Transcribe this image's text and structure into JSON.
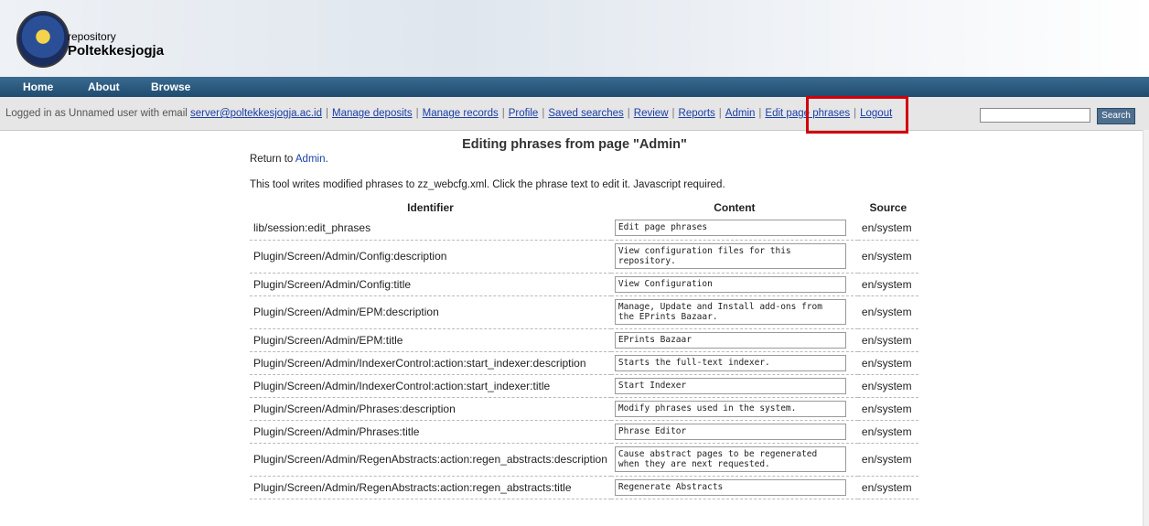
{
  "header": {
    "logo_line1": "repository",
    "logo_line2": "Poltekkesjogja"
  },
  "nav": {
    "home": "Home",
    "about": "About",
    "browse": "Browse"
  },
  "userbar": {
    "prefix": "Logged in as Unnamed user with email ",
    "email": "server@poltekkesjogja.ac.id",
    "links": [
      "Manage deposits",
      "Manage records",
      "Profile",
      "Saved searches",
      "Review",
      "Reports",
      "Admin",
      "Edit page phrases",
      "Logout"
    ],
    "search_button": "Search"
  },
  "page": {
    "title": "Editing phrases from page \"Admin\"",
    "return_prefix": "Return to ",
    "return_link": "Admin",
    "return_suffix": ".",
    "info": "This tool writes modified phrases to zz_webcfg.xml. Click the phrase text to edit it. Javascript required."
  },
  "table": {
    "headers": [
      "Identifier",
      "Content",
      "Source"
    ],
    "rows": [
      {
        "id": "lib/session:edit_phrases",
        "content": "Edit page phrases",
        "source": "en/system"
      },
      {
        "id": "Plugin/Screen/Admin/Config:description",
        "content": "View configuration files for this repository.",
        "source": "en/system"
      },
      {
        "id": "Plugin/Screen/Admin/Config:title",
        "content": "View Configuration",
        "source": "en/system"
      },
      {
        "id": "Plugin/Screen/Admin/EPM:description",
        "content": "Manage, Update and Install add-ons from the EPrints Bazaar.",
        "source": "en/system"
      },
      {
        "id": "Plugin/Screen/Admin/EPM:title",
        "content": "EPrints Bazaar",
        "source": "en/system"
      },
      {
        "id": "Plugin/Screen/Admin/IndexerControl:action:start_indexer:description",
        "content": "Starts the full-text indexer.",
        "source": "en/system"
      },
      {
        "id": "Plugin/Screen/Admin/IndexerControl:action:start_indexer:title",
        "content": "Start Indexer",
        "source": "en/system"
      },
      {
        "id": "Plugin/Screen/Admin/Phrases:description",
        "content": "Modify phrases used in the system.",
        "source": "en/system"
      },
      {
        "id": "Plugin/Screen/Admin/Phrases:title",
        "content": "Phrase Editor",
        "source": "en/system"
      },
      {
        "id": "Plugin/Screen/Admin/RegenAbstracts:action:regen_abstracts:description",
        "content": "Cause abstract pages to be regenerated when they are next requested.",
        "source": "en/system"
      },
      {
        "id": "Plugin/Screen/Admin/RegenAbstracts:action:regen_abstracts:title",
        "content": "Regenerate Abstracts",
        "source": "en/system"
      }
    ]
  }
}
